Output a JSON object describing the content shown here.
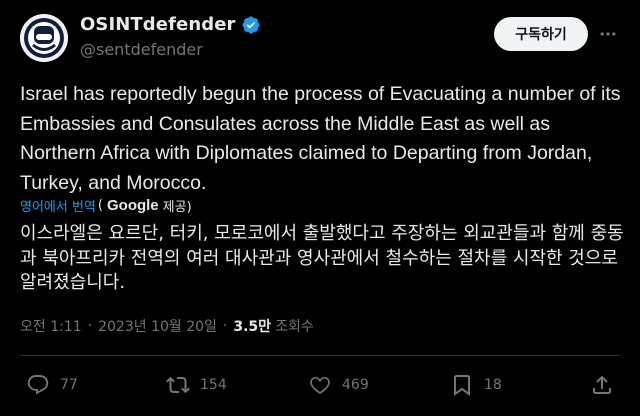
{
  "author": {
    "display_name": "OSINTdefender",
    "handle": "@sentdefender",
    "verified": true,
    "avatar_icon": "osint-defender-logo"
  },
  "header": {
    "follow_label": "구독하기",
    "more_icon": "more-dots-icon"
  },
  "tweet": {
    "text": "Israel has reportedly begun the process of Evacuating a number of its Embassies and Consulates across the Middle East as well as Northern Africa with Diplomates claimed to Departing from Jordan, Turkey, and Morocco.",
    "translate_link": "영어에서 번역",
    "translate_open_paren": "(",
    "translate_provider": "Google",
    "translate_suffix": "제공)",
    "translated_text": "이스라엘은 요르단, 터키, 모로코에서 출발했다고 주장하는 외교관들과 함께 중동과 북아프리카 전역의 여러 대사관과 영사관에서 철수하는 절차를 시작한 것으로 알려졌습니다."
  },
  "meta": {
    "time": "오전 1:11",
    "separator": "·",
    "date": "2023년 10월 20일",
    "views_count": "3.5만",
    "views_label": "조회수"
  },
  "actions": {
    "replies": "77",
    "reposts": "154",
    "likes": "469",
    "bookmarks": "18"
  },
  "colors": {
    "background": "#000000",
    "text_primary": "#e7e9ea",
    "text_secondary": "#71767b",
    "link": "#1d9bf0",
    "verified_badge": "#1d9bf0",
    "follow_button_bg": "#eff3f4"
  }
}
